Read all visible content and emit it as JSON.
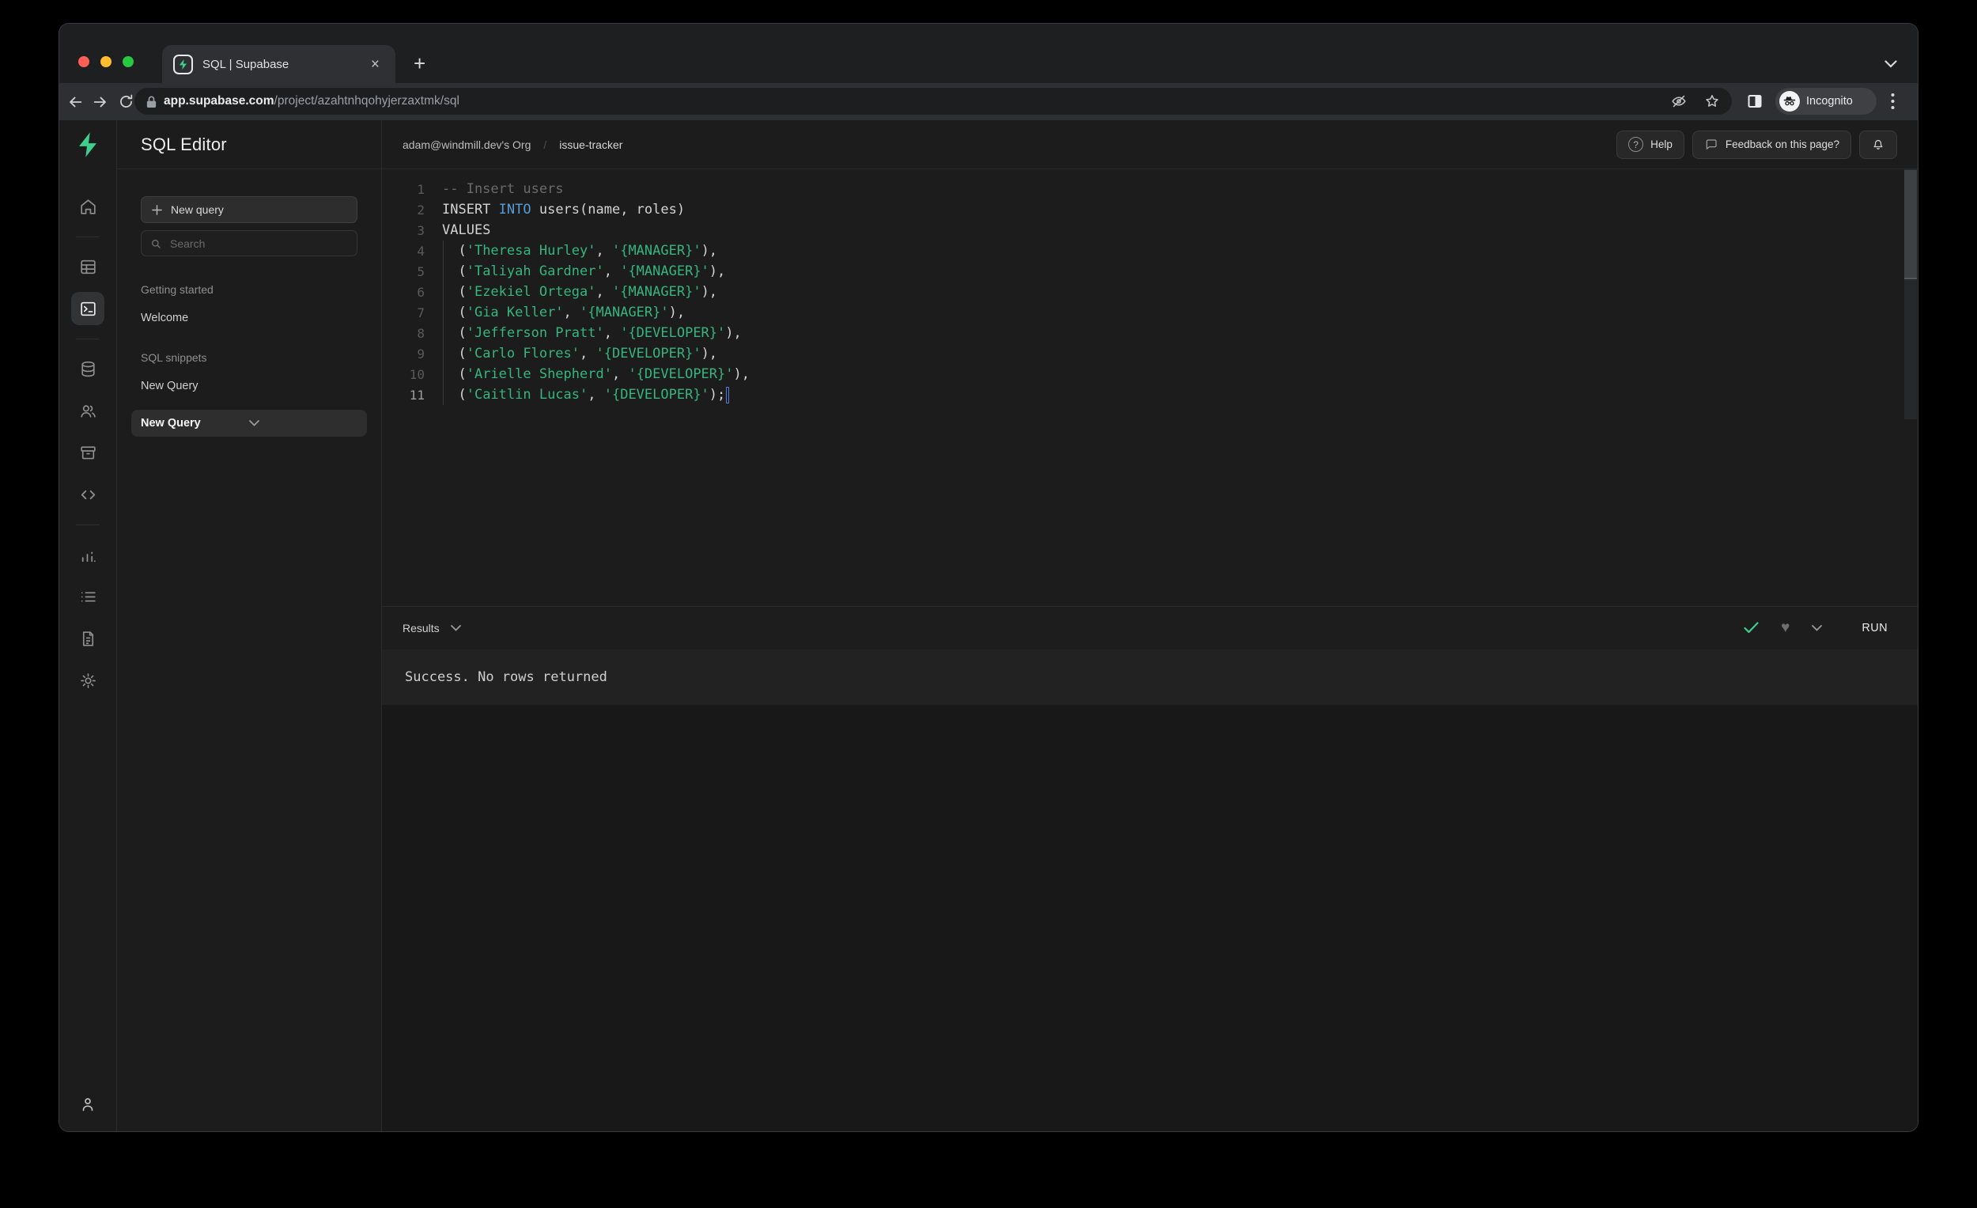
{
  "browser": {
    "tab_title": "SQL | Supabase",
    "url": {
      "host": "app.supabase.com",
      "path": "/project/azahtnhqohyjerzaxtmk/sql"
    },
    "incognito_label": "Incognito"
  },
  "rail": {
    "icons": [
      "supabase-logo",
      "home",
      "table-editor",
      "sql-editor",
      "database",
      "auth-users",
      "storage",
      "edge-functions",
      "reports",
      "logs",
      "api-docs",
      "settings",
      "account"
    ],
    "active_icon": "sql-editor"
  },
  "sidebar": {
    "title": "SQL Editor",
    "new_query_button": "New query",
    "search_placeholder": "Search",
    "sections": [
      {
        "label": "Getting started",
        "items": [
          {
            "label": "Welcome",
            "active": false
          }
        ]
      },
      {
        "label": "SQL snippets",
        "items": [
          {
            "label": "New Query",
            "active": false
          },
          {
            "label": "New Query",
            "active": true,
            "has_chevron": true
          }
        ]
      }
    ]
  },
  "header": {
    "breadcrumb": {
      "org": "adam@windmill.dev's Org",
      "separator": "/",
      "project": "issue-tracker"
    },
    "help_button": "Help",
    "feedback_button": "Feedback on this page?"
  },
  "editor": {
    "language": "sql",
    "token_colors": {
      "plain": "#d4d4d4",
      "comment": "#6a6a6a",
      "keyword": "#569cd6",
      "string": "#35b57f"
    },
    "cursor_color": "#4e7cd6",
    "lines": [
      {
        "num": "1",
        "segments": [
          [
            "comment",
            "-- Insert users"
          ]
        ]
      },
      {
        "num": "2",
        "segments": [
          [
            "plain",
            "INSERT "
          ],
          [
            "keyword",
            "INTO"
          ],
          [
            "plain",
            " users(name, roles)"
          ]
        ]
      },
      {
        "num": "3",
        "segments": [
          [
            "plain",
            "VALUES"
          ]
        ]
      },
      {
        "num": "4",
        "segments": [
          [
            "plain",
            "  ("
          ],
          [
            "string",
            "'Theresa Hurley'"
          ],
          [
            "plain",
            ", "
          ],
          [
            "string",
            "'{MANAGER}'"
          ],
          [
            "plain",
            "),"
          ]
        ]
      },
      {
        "num": "5",
        "segments": [
          [
            "plain",
            "  ("
          ],
          [
            "string",
            "'Taliyah Gardner'"
          ],
          [
            "plain",
            ", "
          ],
          [
            "string",
            "'{MANAGER}'"
          ],
          [
            "plain",
            "),"
          ]
        ]
      },
      {
        "num": "6",
        "segments": [
          [
            "plain",
            "  ("
          ],
          [
            "string",
            "'Ezekiel Ortega'"
          ],
          [
            "plain",
            ", "
          ],
          [
            "string",
            "'{MANAGER}'"
          ],
          [
            "plain",
            "),"
          ]
        ]
      },
      {
        "num": "7",
        "segments": [
          [
            "plain",
            "  ("
          ],
          [
            "string",
            "'Gia Keller'"
          ],
          [
            "plain",
            ", "
          ],
          [
            "string",
            "'{MANAGER}'"
          ],
          [
            "plain",
            "),"
          ]
        ]
      },
      {
        "num": "8",
        "segments": [
          [
            "plain",
            "  ("
          ],
          [
            "string",
            "'Jefferson Pratt'"
          ],
          [
            "plain",
            ", "
          ],
          [
            "string",
            "'{DEVELOPER}'"
          ],
          [
            "plain",
            "),"
          ]
        ]
      },
      {
        "num": "9",
        "segments": [
          [
            "plain",
            "  ("
          ],
          [
            "string",
            "'Carlo Flores'"
          ],
          [
            "plain",
            ", "
          ],
          [
            "string",
            "'{DEVELOPER}'"
          ],
          [
            "plain",
            "),"
          ]
        ]
      },
      {
        "num": "10",
        "segments": [
          [
            "plain",
            "  ("
          ],
          [
            "string",
            "'Arielle Shepherd'"
          ],
          [
            "plain",
            ", "
          ],
          [
            "string",
            "'{DEVELOPER}'"
          ],
          [
            "plain",
            "),"
          ]
        ]
      },
      {
        "num": "11",
        "segments": [
          [
            "plain",
            "  ("
          ],
          [
            "string",
            "'Caitlin Lucas'"
          ],
          [
            "plain",
            ", "
          ],
          [
            "string",
            "'{DEVELOPER}'"
          ],
          [
            "plain",
            ");"
          ]
        ],
        "active": true,
        "cursor": true
      }
    ]
  },
  "results": {
    "label": "Results",
    "run_button": "RUN",
    "message": "Success. No rows returned"
  },
  "colors": {
    "accent_green": "#3ecf8e",
    "check_green": "#3ecf8e",
    "traffic_red": "#ff5f57",
    "traffic_yellow": "#febc2e",
    "traffic_green": "#28c840"
  }
}
